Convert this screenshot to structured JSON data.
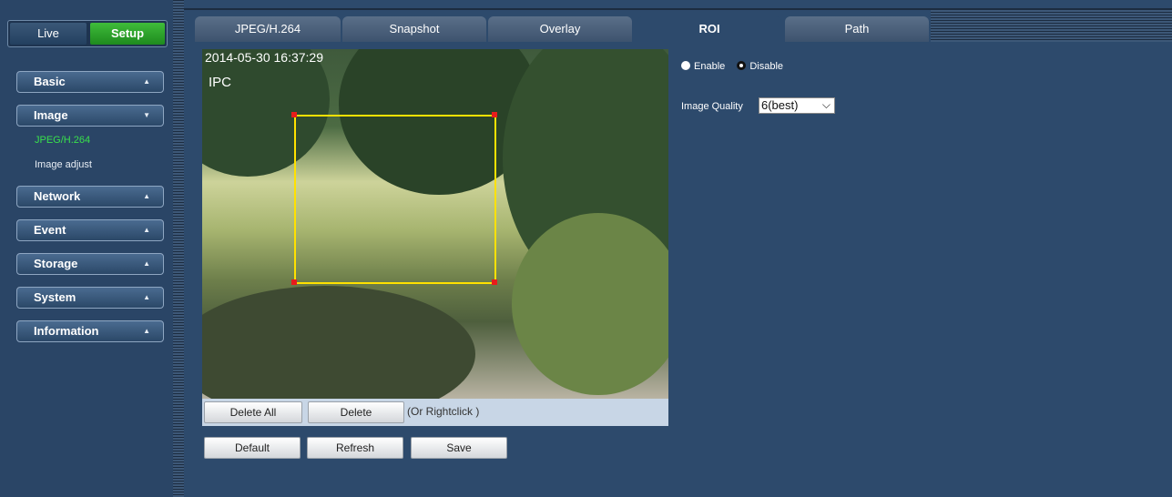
{
  "mode": {
    "live": "Live",
    "setup": "Setup"
  },
  "menu": {
    "basic": "Basic",
    "image": "Image",
    "image_sub": [
      "JPEG/H.264",
      "Image adjust"
    ],
    "network": "Network",
    "event": "Event",
    "storage": "Storage",
    "system": "System",
    "information": "Information"
  },
  "tabs": [
    "JPEG/H.264",
    "Snapshot",
    "Overlay",
    "ROI",
    "Path"
  ],
  "active_tab": "ROI",
  "video": {
    "timestamp": "2014-05-30 16:37:29",
    "channel": "IPC"
  },
  "roi_actions": {
    "delete_all": "Delete All",
    "delete": "Delete",
    "hint": "(Or Rightclick )"
  },
  "footer_buttons": {
    "default": "Default",
    "refresh": "Refresh",
    "save": "Save"
  },
  "settings": {
    "enable_label": "Enable",
    "disable_label": "Disable",
    "image_quality_label": "Image Quality",
    "image_quality_value": "6(best)"
  },
  "colors": {
    "accent_green": "#39e04c",
    "roi_box": "#ffe100",
    "roi_corner": "#e81c1c",
    "background": "#2d4a6c"
  }
}
